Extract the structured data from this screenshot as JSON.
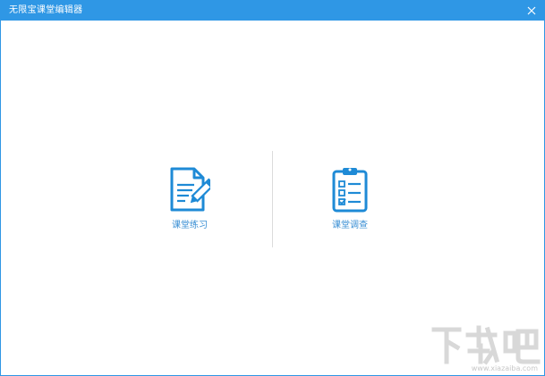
{
  "window": {
    "title": "无限宝课堂编辑器",
    "accent_color": "#2f97e5"
  },
  "titlebar": {
    "close_icon": "close-icon"
  },
  "main": {
    "cards": [
      {
        "label": "课堂练习",
        "icon": "document-pencil-icon"
      },
      {
        "label": "课堂调查",
        "icon": "clipboard-checklist-icon"
      }
    ]
  },
  "watermark": {
    "text": "下载吧",
    "url": "www.xiazaiba.com"
  }
}
